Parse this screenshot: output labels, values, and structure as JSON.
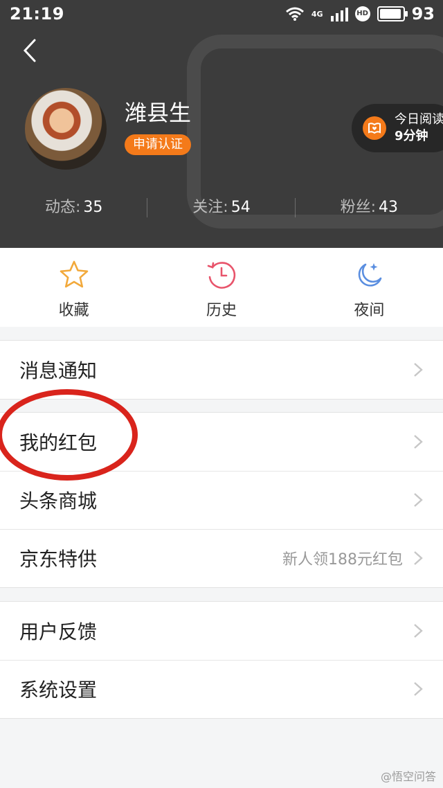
{
  "status_bar": {
    "time": "21:19",
    "network": "4G",
    "hd": "HD",
    "battery_pct": "93"
  },
  "profile": {
    "username": "潍县生",
    "verify_label": "申请认证",
    "reading": {
      "line1": "今日阅读",
      "line2": "9分钟"
    },
    "stats": [
      {
        "label": "动态:",
        "value": "35"
      },
      {
        "label": "关注:",
        "value": "54"
      },
      {
        "label": "粉丝:",
        "value": "43"
      }
    ]
  },
  "quick_actions": [
    {
      "label": "收藏",
      "icon": "star-icon"
    },
    {
      "label": "历史",
      "icon": "clock-icon"
    },
    {
      "label": "夜间",
      "icon": "moon-icon"
    }
  ],
  "menu": {
    "group1": [
      {
        "title": "消息通知",
        "sub": ""
      }
    ],
    "group2": [
      {
        "title": "我的红包",
        "sub": ""
      },
      {
        "title": "头条商城",
        "sub": ""
      },
      {
        "title": "京东特供",
        "sub": "新人领188元红包"
      }
    ],
    "group3": [
      {
        "title": "用户反馈",
        "sub": ""
      },
      {
        "title": "系统设置",
        "sub": ""
      }
    ]
  },
  "watermark": "@悟空问答",
  "colors": {
    "accent": "#f47a1a",
    "header_bg": "#3c3c3c",
    "annotation_red": "#d9241c"
  }
}
